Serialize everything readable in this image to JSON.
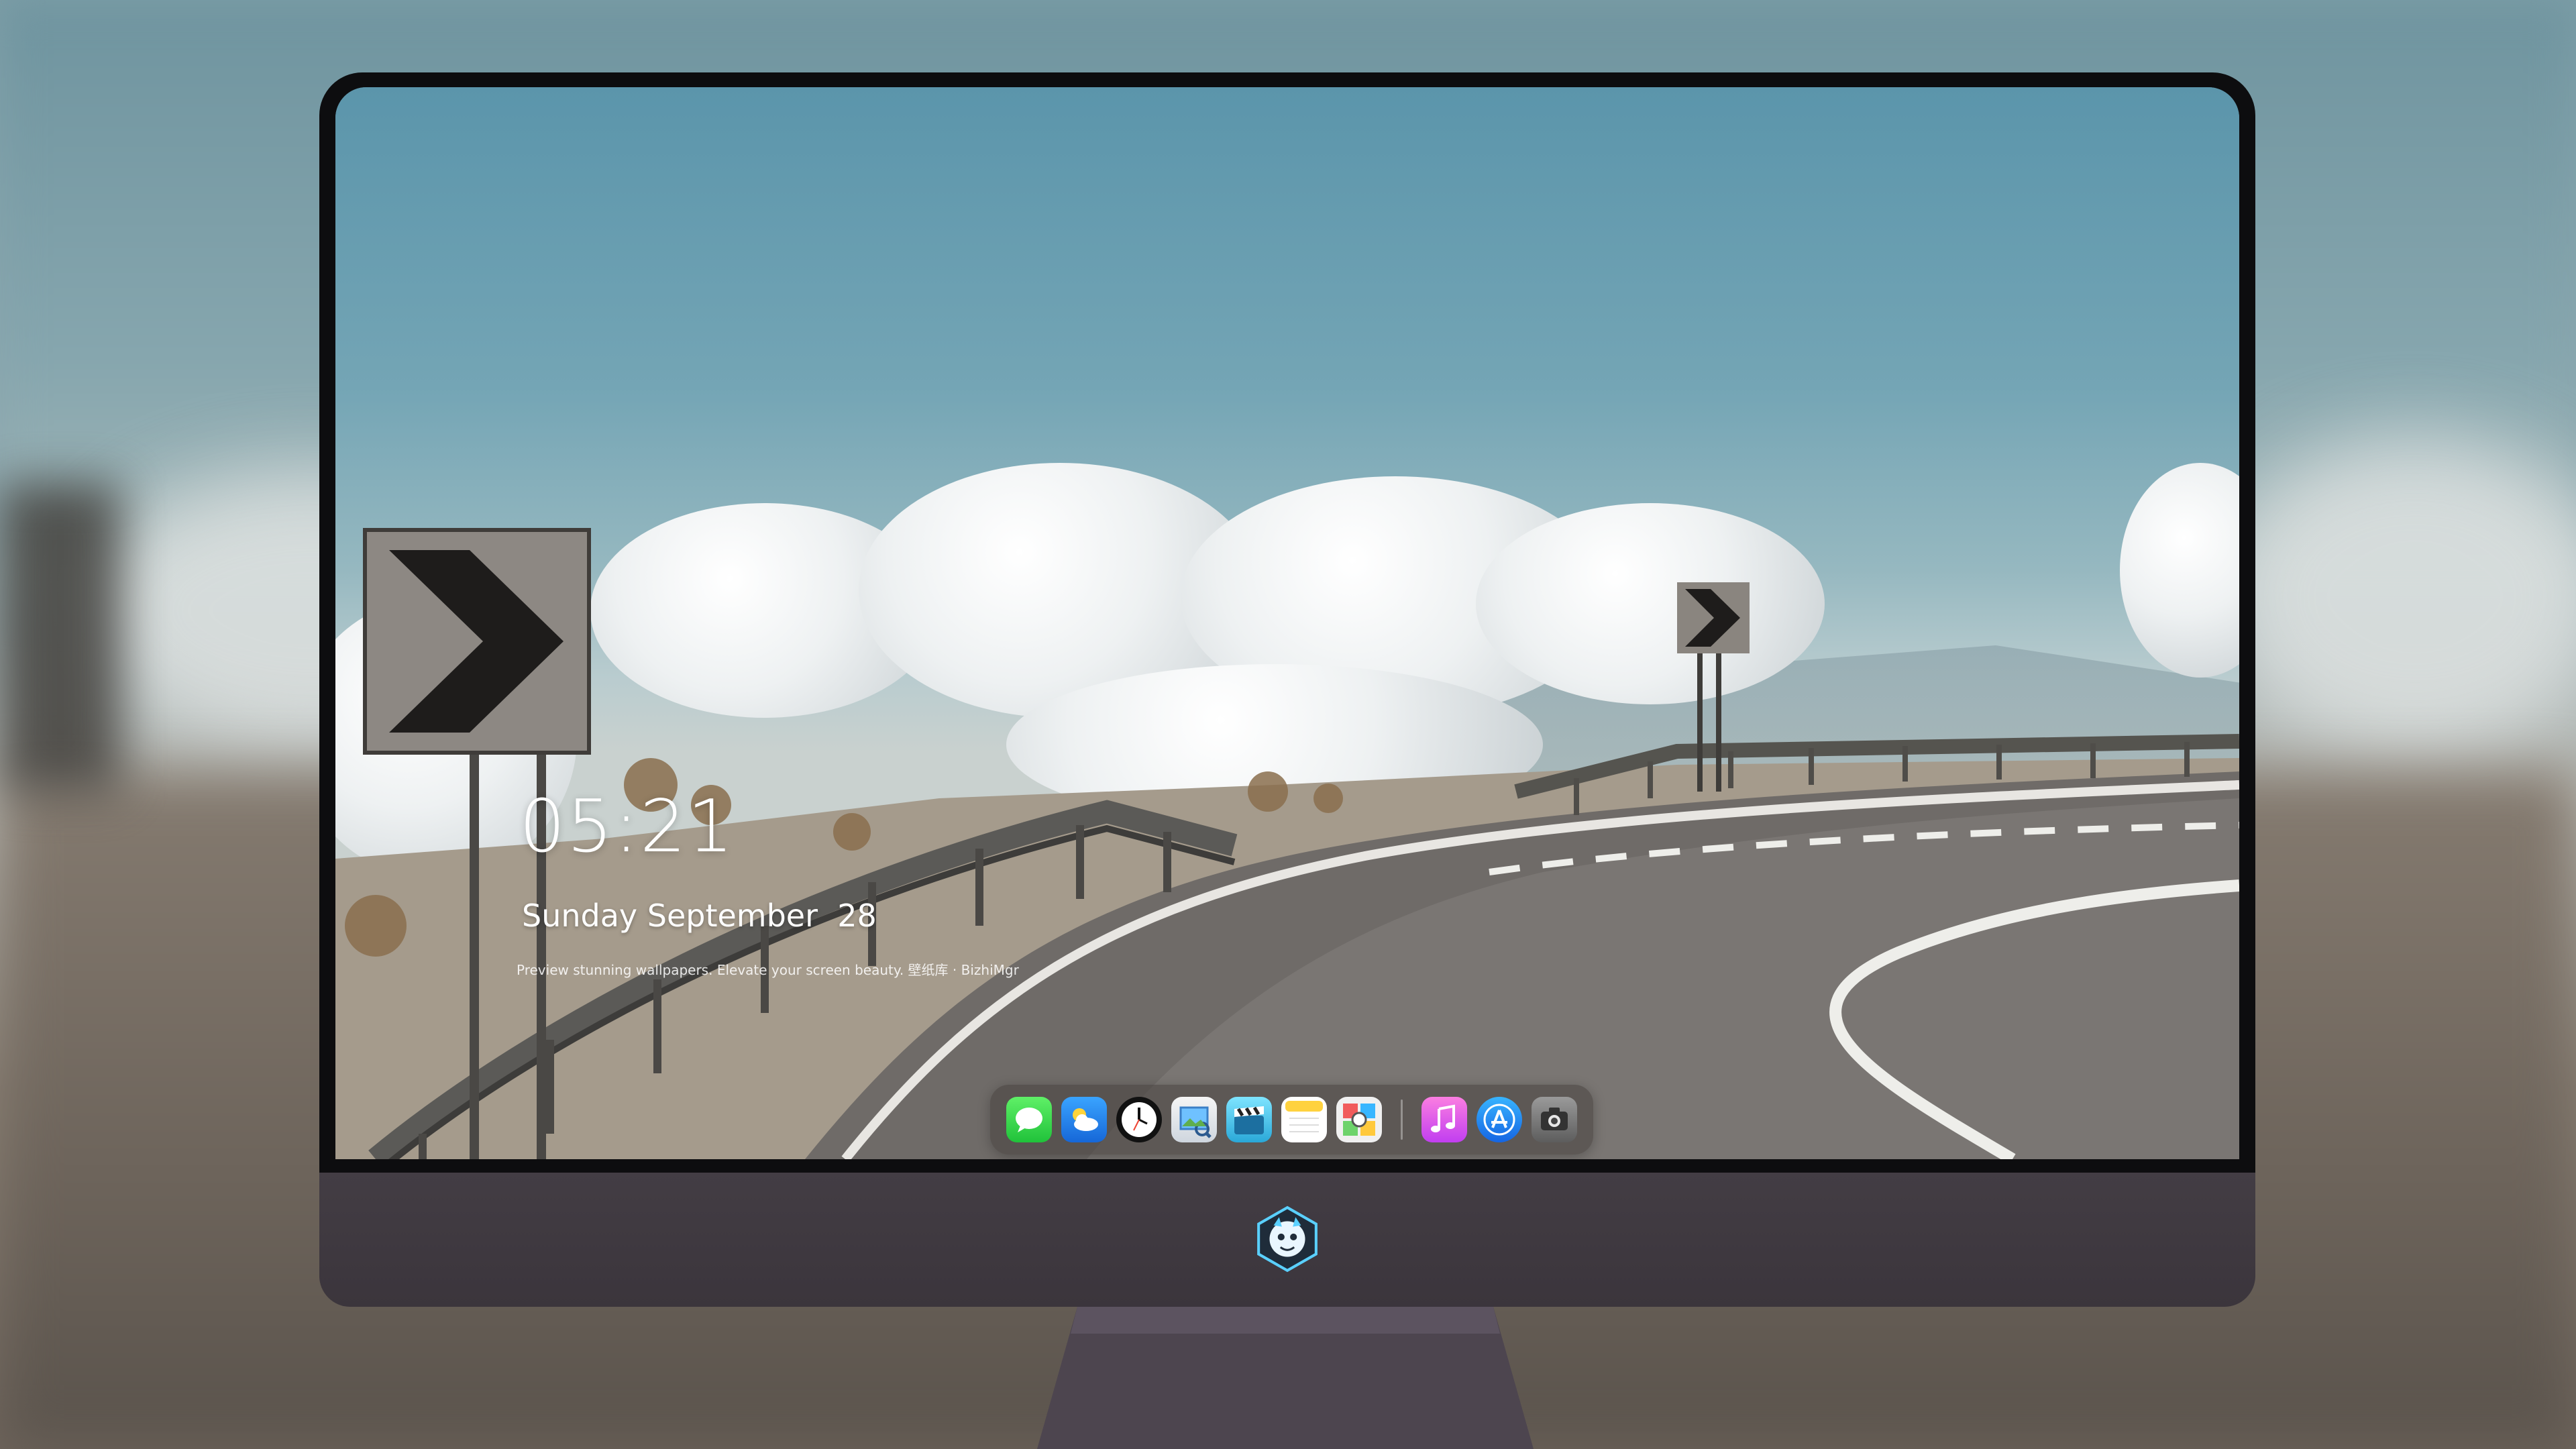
{
  "lockscreen": {
    "time": "05:21",
    "date": "Sunday September  28",
    "tagline": "Preview stunning wallpapers. Elevate your screen beauty. 壁纸库 · BizhiMgr"
  },
  "dock": {
    "apps": [
      {
        "icon": "messages-icon"
      },
      {
        "icon": "weather-icon"
      },
      {
        "icon": "clock-icon"
      },
      {
        "icon": "preview-icon"
      },
      {
        "icon": "clips-icon"
      },
      {
        "icon": "notes-icon"
      },
      {
        "icon": "photo-booth-icon"
      },
      {
        "icon": "music-icon"
      },
      {
        "icon": "app-store-icon"
      },
      {
        "icon": "camera-icon"
      }
    ]
  },
  "colors": {
    "bezel": "#0d0d0f",
    "chin": "#3e383f",
    "sky": "#5b95ab",
    "road": "#6f6b68"
  }
}
